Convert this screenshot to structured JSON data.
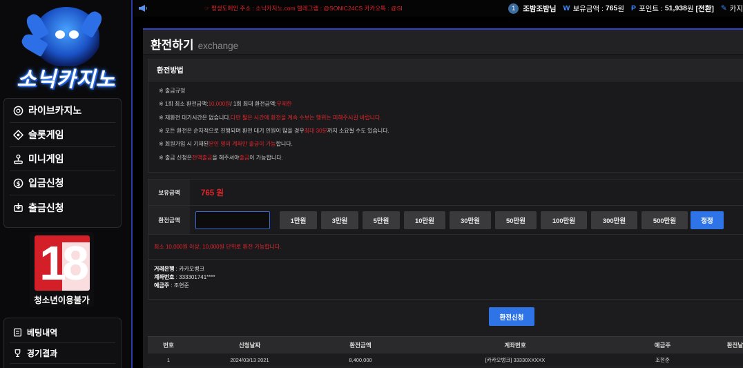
{
  "brand": {
    "name": "소닉카지노"
  },
  "sidebar": {
    "items": [
      {
        "label": "라이브카지노",
        "icon": "roulette-icon"
      },
      {
        "label": "슬롯게임",
        "icon": "slot-icon"
      },
      {
        "label": "미니게임",
        "icon": "joystick-icon"
      },
      {
        "label": "입금신청",
        "icon": "coin-icon"
      },
      {
        "label": "출금신청",
        "icon": "withdraw-icon"
      }
    ],
    "age_badge": {
      "number": "18",
      "label": "청소년이용불가"
    },
    "items2": [
      {
        "label": "베팅내역",
        "icon": "receipt-icon"
      },
      {
        "label": "경기결과",
        "icon": "trophy-icon"
      }
    ]
  },
  "topbar": {
    "notice": "☞ 평생도메인 주소 : 소닉카지노.com 텔레그램 : @SONIC24CS 카카오톡 : @SI",
    "user": {
      "level": "1",
      "name": "조밤조밤님",
      "balance_label": "보유금액 :",
      "balance_value": "765",
      "balance_unit": "원",
      "point_label": "포인트 :",
      "point_value": "51,938",
      "point_unit": "원",
      "convert": "[전환]",
      "trail": "카지"
    }
  },
  "page": {
    "title": "환전하기",
    "subtitle": "exchange"
  },
  "rules": {
    "heading": "환전방법",
    "lines": [
      {
        "pre": "※ 출금규정",
        "red": "",
        "post": "",
        "red2": "",
        "post2": ""
      },
      {
        "pre": "※ 1회 최소 환전금액: ",
        "red": "10,000원",
        "post": " / 1회 최대 환전금액: ",
        "red2": "무제한",
        "post2": ""
      },
      {
        "pre": "※ 재환전 대기시간은 없습니다. ",
        "red": "다만 짧은 시간에 환전을 계속 수보는 행위는 피해주시길 바랍니다.",
        "post": "",
        "red2": "",
        "post2": ""
      },
      {
        "pre": "※ 모든 환전은 순차적으로 진행되며 환전 대기 인원이 많을 경우 ",
        "red": "최대 30분",
        "post": " 까지 소요될 수도 있습니다.",
        "red2": "",
        "post2": ""
      },
      {
        "pre": "※ 회원가입 시 기재된 ",
        "red": "본인 명의 계좌만 출금이 가능",
        "post": " 합니다.",
        "red2": "",
        "post2": ""
      },
      {
        "pre": "※ 출금 신청은 ",
        "red": "전액출금",
        "post": " 을 해주셔야 ",
        "red2": "출금",
        "post2": "이 가능합니다."
      }
    ]
  },
  "form": {
    "balance_label": "보유금액",
    "balance_value": "765 원",
    "amount_label": "환전금액",
    "amount_value": "",
    "amount_buttons": [
      "1만원",
      "3만원",
      "5만원",
      "10만원",
      "30만원",
      "50만원",
      "100만원",
      "300만원",
      "500만원"
    ],
    "reset_label": "정정",
    "min_note": "최소 10,000원 이상, 10,000원 단위로 환전 가능합니다.",
    "bank": {
      "bank_label": "거래은행",
      "bank_value": "카카오뱅크",
      "account_label": "계좌번호",
      "account_value": "333301741****",
      "holder_label": "예금주",
      "holder_value": "조현준"
    },
    "submit_label": "환전신청"
  },
  "history": {
    "headers": [
      "번호",
      "신청날짜",
      "환전금액",
      "계좌번호",
      "예금주",
      "환전날짜"
    ],
    "rows": [
      [
        "1",
        "2024/03/13 2021",
        "8,400,000",
        "[카카오뱅크] 33330XXXXX",
        "조현준",
        ""
      ]
    ]
  },
  "colors": {
    "accent": "#2f74e6",
    "warning": "#e0262c",
    "panel_border": "#2e45c9"
  }
}
